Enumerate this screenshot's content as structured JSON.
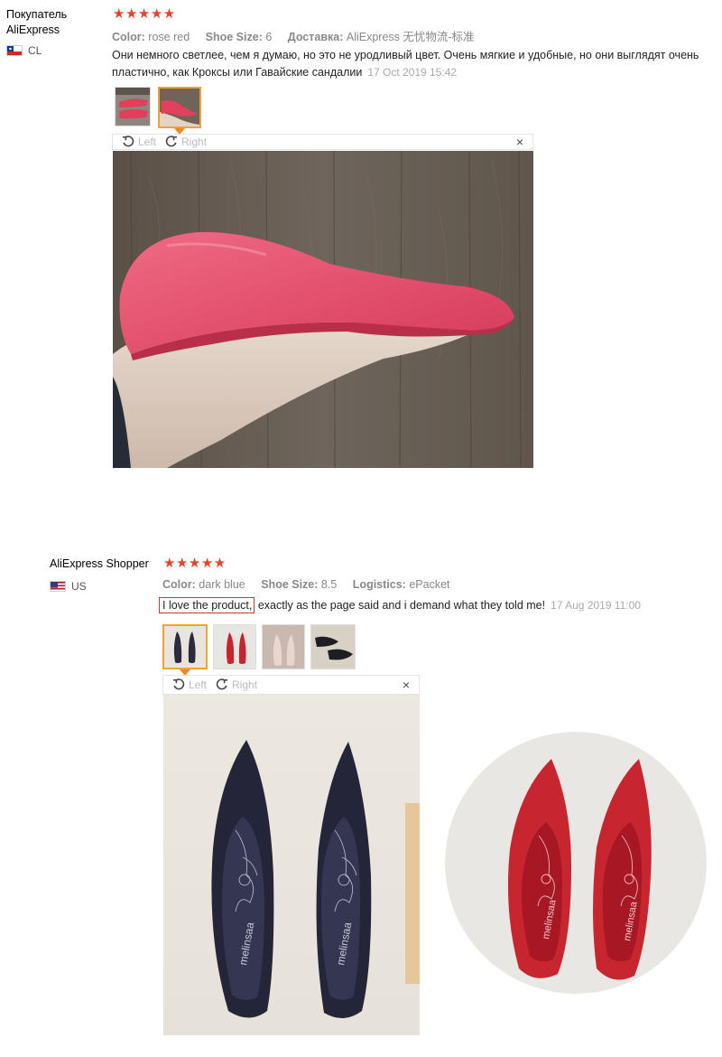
{
  "reviews": [
    {
      "user_name_line1": "Покупатель",
      "user_name_line2": "AliExpress",
      "country": "CL",
      "stars": "★★★★★",
      "meta": {
        "color_label": "Color:",
        "color_value": "rose red",
        "size_label": "Shoe Size:",
        "size_value": "6",
        "shipping_label": "Доставка:",
        "shipping_value": "AliExpress 无忧物流-标准"
      },
      "text_line1": "Они немного светлее, чем я думаю, но это не уродливый цвет. Очень мягкие и удобные, но они выглядят очень",
      "text_line2": "пластично, как Кроксы или Гавайские сандалии",
      "date": "17 Oct 2019 15:42",
      "viewer": {
        "left": "Left",
        "right": "Right",
        "close": "×"
      }
    },
    {
      "user_name": "AliExpress Shopper",
      "country": "US",
      "stars": "★★★★★",
      "meta": {
        "color_label": "Color:",
        "color_value": "dark blue",
        "size_label": "Shoe Size:",
        "size_value": "8.5",
        "shipping_label": "Logistics:",
        "shipping_value": "ePacket"
      },
      "text_highlight": "I love the product,",
      "text_rest": " exactly as the page said and i demand what they told me!",
      "date": "17 Aug 2019 11:00",
      "viewer": {
        "left": "Left",
        "right": "Right",
        "close": "×"
      },
      "insole_brand": "melinsaa"
    }
  ],
  "colors": {
    "star": "#e8412c",
    "active_thumb": "#f0a23a",
    "highlight_box": "#d9342b"
  }
}
